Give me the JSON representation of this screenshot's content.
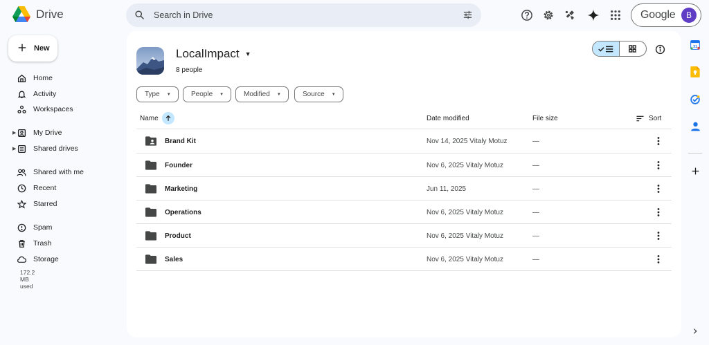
{
  "app": {
    "name": "Drive"
  },
  "search": {
    "placeholder": "Search in Drive"
  },
  "account": {
    "brand": "Google",
    "initial": "B"
  },
  "sidebar": {
    "new_label": "New",
    "items": [
      {
        "label": "Home"
      },
      {
        "label": "Activity"
      },
      {
        "label": "Workspaces"
      },
      {
        "label": "My Drive"
      },
      {
        "label": "Shared drives"
      },
      {
        "label": "Shared with me"
      },
      {
        "label": "Recent"
      },
      {
        "label": "Starred"
      },
      {
        "label": "Spam"
      },
      {
        "label": "Trash"
      },
      {
        "label": "Storage"
      }
    ],
    "storage_used": "172.2 MB used"
  },
  "folder": {
    "title": "LocalImpact",
    "subtitle": "8 people"
  },
  "filters": [
    "Type",
    "People",
    "Modified",
    "Source"
  ],
  "table": {
    "headers": {
      "name": "Name",
      "date": "Date modified",
      "size": "File size",
      "sort": "Sort"
    },
    "rows": [
      {
        "name": "Brand Kit",
        "date": "Nov 14, 2025 Vitaly Motuz",
        "size": "—",
        "icon": "shared-folder-icon"
      },
      {
        "name": "Founder",
        "date": "Nov 6, 2025 Vitaly Motuz",
        "size": "—",
        "icon": "folder-icon"
      },
      {
        "name": "Marketing",
        "date": "Jun 11, 2025",
        "size": "—",
        "icon": "folder-icon"
      },
      {
        "name": "Operations",
        "date": "Nov 6, 2025 Vitaly Motuz",
        "size": "—",
        "icon": "folder-icon"
      },
      {
        "name": "Product",
        "date": "Nov 6, 2025 Vitaly Motuz",
        "size": "—",
        "icon": "folder-icon"
      },
      {
        "name": "Sales",
        "date": "Nov 6, 2025 Vitaly Motuz",
        "size": "—",
        "icon": "folder-icon"
      }
    ]
  },
  "colors": {
    "accent_light": "#c2e7ff",
    "search_bg": "#e9eef6",
    "page_bg": "#f8fafd",
    "avatar": "#5f3dc4"
  }
}
